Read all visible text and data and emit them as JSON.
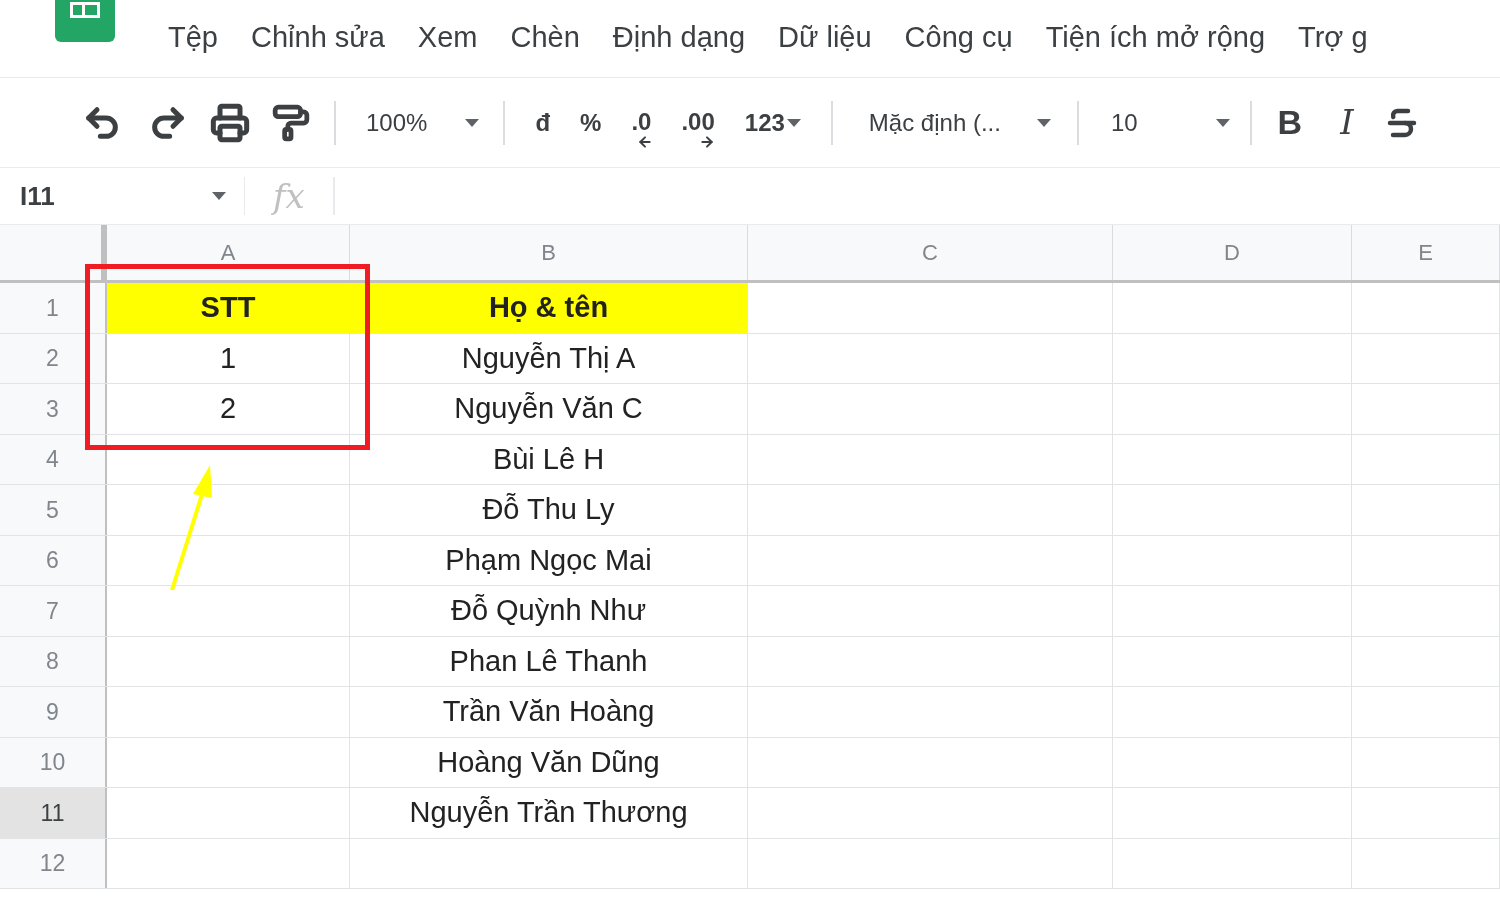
{
  "menu": [
    "Tệp",
    "Chỉnh sửa",
    "Xem",
    "Chèn",
    "Định dạng",
    "Dữ liệu",
    "Công cụ",
    "Tiện ích mở rộng",
    "Trợ g"
  ],
  "toolbar": {
    "zoom": "100%",
    "number_formats": [
      {
        "label": "đ",
        "kind": "plain"
      },
      {
        "label": "%",
        "kind": "plain"
      },
      {
        "label": ".0",
        "kind": "arrow-left"
      },
      {
        "label": ".00",
        "kind": "arrow-right"
      },
      {
        "label": "123",
        "kind": "dropdown"
      }
    ],
    "font": "Mặc định (...",
    "font_size": "10",
    "bold": "B",
    "italic": "I"
  },
  "formula_bar": {
    "cell_ref": "I11",
    "fx": "fx"
  },
  "grid": {
    "columns": [
      {
        "label": "A",
        "selected": false
      },
      {
        "label": "B",
        "selected": false
      },
      {
        "label": "C",
        "selected": false
      },
      {
        "label": "D",
        "selected": false
      },
      {
        "label": "E",
        "selected": false
      }
    ],
    "rows": [
      {
        "number": "1",
        "selected": false,
        "kind": "header",
        "cells": [
          "STT",
          "Họ & tên"
        ]
      },
      {
        "number": "2",
        "selected": false,
        "kind": "data",
        "cells": [
          "1",
          "Nguyễn Thị A"
        ]
      },
      {
        "number": "3",
        "selected": false,
        "kind": "data",
        "cells": [
          "2",
          "Nguyễn Văn C"
        ]
      },
      {
        "number": "4",
        "selected": false,
        "kind": "data",
        "cells": [
          "",
          "Bùi Lê H"
        ]
      },
      {
        "number": "5",
        "selected": false,
        "kind": "data",
        "cells": [
          "",
          "Đỗ Thu Ly"
        ]
      },
      {
        "number": "6",
        "selected": false,
        "kind": "data",
        "cells": [
          "",
          "Phạm Ngọc Mai"
        ]
      },
      {
        "number": "7",
        "selected": false,
        "kind": "data",
        "cells": [
          "",
          "Đỗ Quỳnh Như"
        ]
      },
      {
        "number": "8",
        "selected": false,
        "kind": "data",
        "cells": [
          "",
          "Phan Lê Thanh"
        ]
      },
      {
        "number": "9",
        "selected": false,
        "kind": "data",
        "cells": [
          "",
          "Trần Văn Hoàng"
        ]
      },
      {
        "number": "10",
        "selected": false,
        "kind": "data",
        "cells": [
          "",
          "Hoàng Văn Dũng"
        ]
      },
      {
        "number": "11",
        "selected": true,
        "kind": "data",
        "cells": [
          "",
          "Nguyễn Trần Thương"
        ]
      },
      {
        "number": "12",
        "selected": false,
        "kind": "data",
        "cells": [
          "",
          ""
        ]
      }
    ]
  }
}
